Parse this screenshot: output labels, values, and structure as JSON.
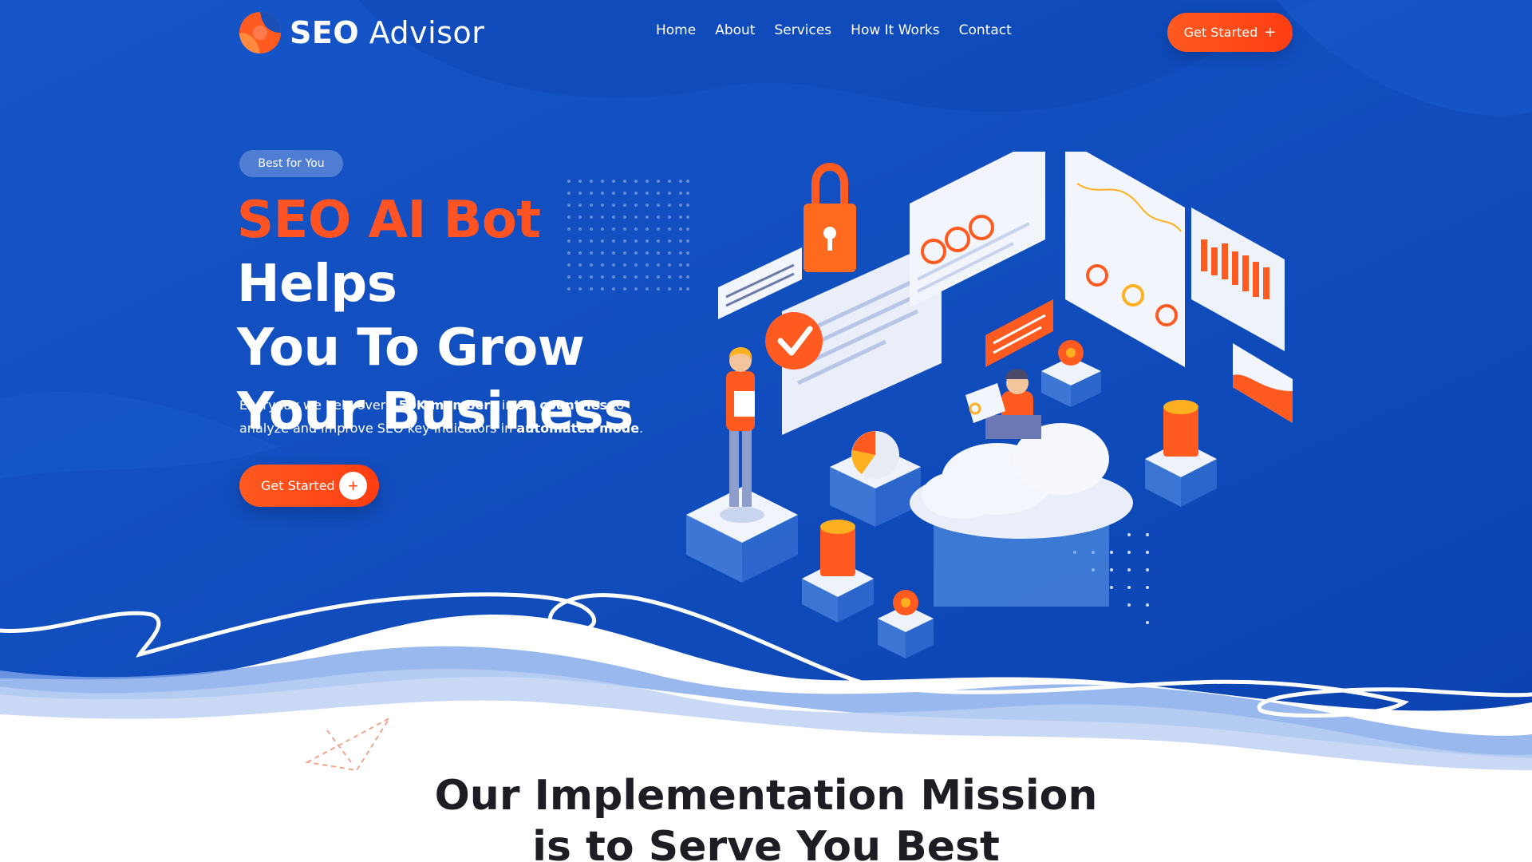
{
  "brand": {
    "name_bold": "SEO",
    "name_light": "Advisor"
  },
  "nav": {
    "items": [
      {
        "label": "Home"
      },
      {
        "label": "About"
      },
      {
        "label": "Services"
      },
      {
        "label": "How It Works"
      },
      {
        "label": "Contact"
      }
    ]
  },
  "header_cta": {
    "label": "Get Started",
    "icon": "+"
  },
  "hero": {
    "badge": "Best for You",
    "title_accent": "SEO AI Bot",
    "title_rest_1": "Helps",
    "title_line_2": "You To Grow",
    "title_line_3": "Your Business",
    "desc_1": "Everyday we help over ",
    "desc_bold_1": "150K members",
    "desc_2": " in ",
    "desc_bold_2": "90 countries",
    "desc_3": " to analyze and improve SEO key indicators in ",
    "desc_bold_3": "automated mode",
    "desc_4": ".",
    "cta_label": "Get Started",
    "cta_icon": "+"
  },
  "mission": {
    "line_1": "Our Implementation Mission",
    "line_2": "is to Serve You Best"
  },
  "colors": {
    "primary_blue": "#0f4fbf",
    "accent_orange": "#ff5323",
    "heading_dark": "#1d1d24"
  }
}
